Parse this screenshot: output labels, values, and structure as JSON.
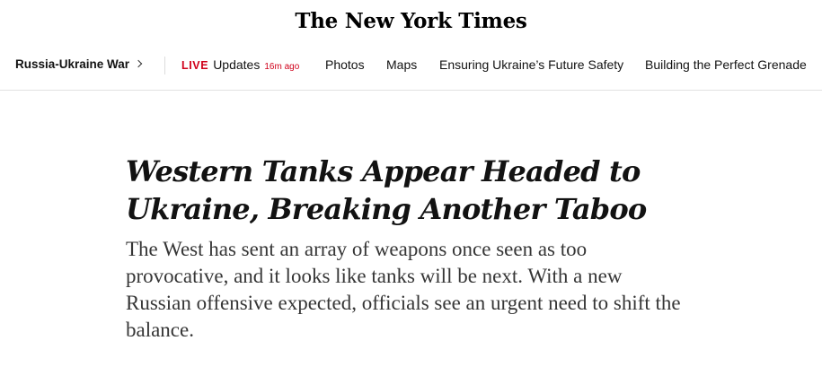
{
  "masthead": {
    "logo": "The New York Times"
  },
  "subnav": {
    "section_title": "Russia-Ukraine War",
    "live": {
      "label": "LIVE",
      "text": "Updates",
      "time": "16m ago"
    },
    "links": [
      {
        "label": "Photos"
      },
      {
        "label": "Maps"
      },
      {
        "label": "Ensuring Ukraine’s Future Safety"
      },
      {
        "label": "Building the Perfect Grenade"
      }
    ]
  },
  "article": {
    "headline": "Western Tanks Appear Headed to Ukraine, Breaking Another Taboo",
    "summary": "The West has sent an array of weapons once seen as too provocative, and it looks like tanks will be next. With a new Russian offensive expected, officials see an urgent need to shift the balance."
  },
  "colors": {
    "live_red": "#d0021b",
    "text": "#121212",
    "summary_text": "#363636",
    "divider": "#e2e2e2"
  }
}
